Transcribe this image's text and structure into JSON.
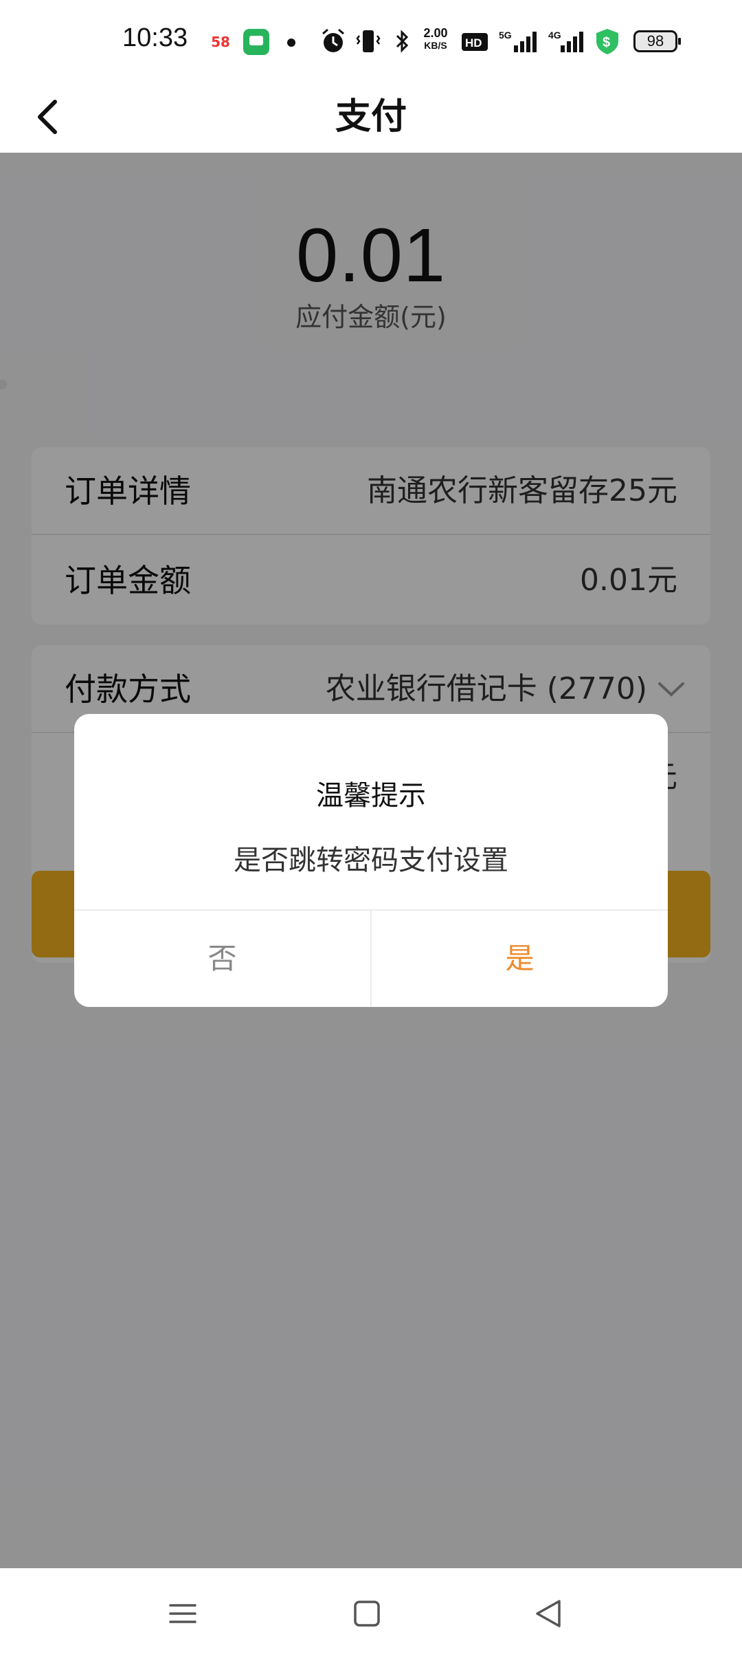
{
  "status_bar": {
    "time": "10:33",
    "app_badge_58": "58",
    "net_speed_value": "2.00",
    "net_speed_unit": "KB/S",
    "battery": "98",
    "shield_color": "#2ec062"
  },
  "title_bar": {
    "title": "支付"
  },
  "amount": {
    "value": "0.01",
    "label": "应付金额(元)"
  },
  "order_card": {
    "detail_label": "订单详情",
    "detail_value": "南通农行新客留存25元",
    "amount_label": "订单金额",
    "amount_value": "0.01元"
  },
  "payment_card": {
    "method_label": "付款方式",
    "method_value": "农业银行借记卡 (2770)",
    "row2_value_partial": "元"
  },
  "dialog": {
    "title": "温馨提示",
    "message": "是否跳转密码支付设置",
    "no_label": "否",
    "yes_label": "是"
  },
  "colors": {
    "accent_button": "#f6b21f",
    "confirm_text": "#ef8a2a"
  },
  "icons": {
    "back": "chevron-left-icon",
    "dropdown": "chevron-down-icon",
    "nav_menu": "menu-icon",
    "nav_home": "square-icon",
    "nav_back": "triangle-back-icon"
  }
}
